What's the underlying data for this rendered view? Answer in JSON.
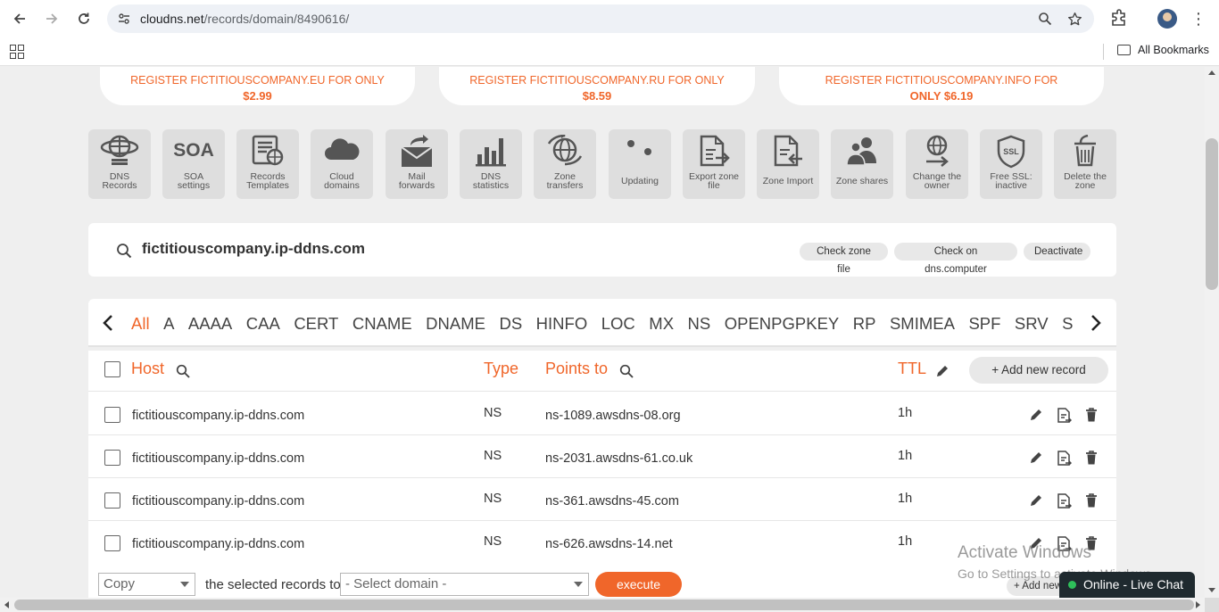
{
  "browser": {
    "url_domain": "cloudns.net",
    "url_path": "/records/domain/8490616/",
    "all_bookmarks_label": "All Bookmarks",
    "icons": [
      "back-icon",
      "forward-icon",
      "reload-icon",
      "site-info-icon",
      "zoom-icon",
      "star-icon",
      "extensions-icon",
      "profile-avatar",
      "menu-icon",
      "apps-icon",
      "folder-icon"
    ]
  },
  "promos": [
    {
      "text": "REGISTER FICTITIOUSCOMPANY.EU FOR ONLY",
      "price": "$2.99"
    },
    {
      "text": "REGISTER FICTITIOUSCOMPANY.RU FOR ONLY",
      "price": "$8.59"
    },
    {
      "text": "REGISTER FICTITIOUSCOMPANY.INFO FOR",
      "price": "ONLY $6.19"
    }
  ],
  "tiles": [
    {
      "l1": "DNS",
      "l2": "Records",
      "icon": "globe-servers-icon"
    },
    {
      "l1": "SOA",
      "l2": "settings",
      "icon": "soa-icon",
      "big": "SOA"
    },
    {
      "l1": "Records",
      "l2": "Templates",
      "icon": "template-globe-icon"
    },
    {
      "l1": "Cloud",
      "l2": "domains",
      "icon": "cloud-icon"
    },
    {
      "l1": "Mail",
      "l2": "forwards",
      "icon": "mail-forward-icon"
    },
    {
      "l1": "DNS",
      "l2": "statistics",
      "icon": "bar-chart-icon"
    },
    {
      "l1": "Zone",
      "l2": "transfers",
      "icon": "globe-transfer-icon"
    },
    {
      "l1": "Updating",
      "l2": "",
      "icon": "updating-dots-icon"
    },
    {
      "l1": "Export zone",
      "l2": "file",
      "icon": "export-file-icon"
    },
    {
      "l1": "Zone Import",
      "l2": "",
      "icon": "import-file-icon"
    },
    {
      "l1": "Zone shares",
      "l2": "",
      "icon": "users-share-icon"
    },
    {
      "l1": "Change the",
      "l2": "owner",
      "icon": "change-owner-icon"
    },
    {
      "l1": "Free SSL:",
      "l2": "inactive",
      "icon": "ssl-shield-icon"
    },
    {
      "l1": "Delete the",
      "l2": "zone",
      "icon": "trash-icon"
    }
  ],
  "zone": {
    "domain": "fictitiouscompany.ip-ddns.com",
    "check_zone_file": "Check zone file",
    "check_dns_computer": "Check on dns.computer",
    "deactivate": "Deactivate"
  },
  "record_types": [
    "All",
    "A",
    "AAAA",
    "CAA",
    "CERT",
    "CNAME",
    "DNAME",
    "DS",
    "HINFO",
    "LOC",
    "MX",
    "NS",
    "OPENPGPKEY",
    "RP",
    "SMIMEA",
    "SPF",
    "SRV",
    "SSHFP"
  ],
  "table": {
    "headers": {
      "host": "Host",
      "type": "Type",
      "points_to": "Points to",
      "ttl": "TTL"
    },
    "add_new_record": "+ Add new record",
    "rows": [
      {
        "host": "fictitiouscompany.ip-ddns.com",
        "type": "NS",
        "points_to": "ns-1089.awsdns-08.org",
        "ttl": "1h"
      },
      {
        "host": "fictitiouscompany.ip-ddns.com",
        "type": "NS",
        "points_to": "ns-2031.awsdns-61.co.uk",
        "ttl": "1h"
      },
      {
        "host": "fictitiouscompany.ip-ddns.com",
        "type": "NS",
        "points_to": "ns-361.awsdns-45.com",
        "ttl": "1h"
      },
      {
        "host": "fictitiouscompany.ip-ddns.com",
        "type": "NS",
        "points_to": "ns-626.awsdns-14.net",
        "ttl": "1h"
      }
    ]
  },
  "bulk": {
    "action_value": "Copy",
    "middle_text": "the selected records to",
    "domain_placeholder": "- Select domain -",
    "execute": "execute",
    "add_new_small": "+ Add new"
  },
  "watermark": {
    "line1": "Activate Windows",
    "line2": "Go to Settings to activate Windows."
  },
  "live_chat": {
    "label": "Online - Live Chat"
  },
  "colors": {
    "accent": "#f0662a",
    "tile_bg": "#dedede",
    "chat_online": "#2ec05a"
  }
}
